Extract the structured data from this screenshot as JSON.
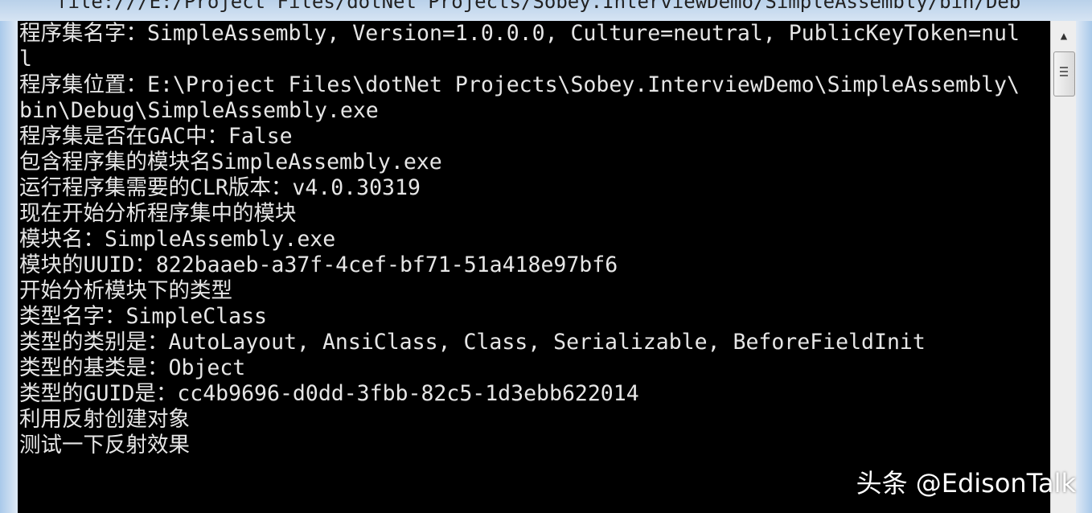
{
  "window": {
    "title": "file:///E:/Project Files/dotNet Projects/Sobey.InterviewDemo/SimpleAssembly/bin/Debug/Sim..."
  },
  "console": {
    "lines": [
      "程序集名字：SimpleAssembly, Version=1.0.0.0, Culture=neutral, PublicKeyToken=nul",
      "l",
      "程序集位置：E:\\Project Files\\dotNet Projects\\Sobey.InterviewDemo\\SimpleAssembly\\",
      "bin\\Debug\\SimpleAssembly.exe",
      "程序集是否在GAC中：False",
      "包含程序集的模块名SimpleAssembly.exe",
      "运行程序集需要的CLR版本：v4.0.30319",
      "现在开始分析程序集中的模块",
      "模块名：SimpleAssembly.exe",
      "模块的UUID：822baaeb-a37f-4cef-bf71-51a418e97bf6",
      "开始分析模块下的类型",
      "类型名字：SimpleClass",
      "类型的类别是：AutoLayout, AnsiClass, Class, Serializable, BeforeFieldInit",
      "类型的基类是：Object",
      "类型的GUID是：cc4b9696-d0dd-3fbb-82c5-1d3ebb622014",
      "利用反射创建对象",
      "测试一下反射效果"
    ]
  },
  "watermark": "头条 @EdisonTalk",
  "colors": {
    "console_bg": "#000000",
    "console_fg": "#e6e6e6"
  }
}
